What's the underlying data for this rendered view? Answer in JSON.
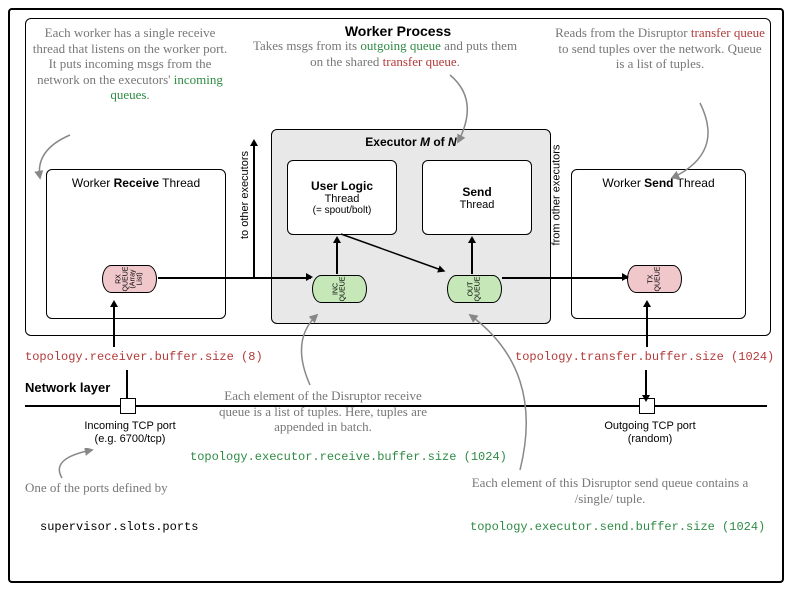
{
  "worker_process_title": "Worker Process",
  "annotations": {
    "recv_thread": "Each worker has a single receive thread that listens on the worker port. It puts incoming msgs from the network on the executors'",
    "recv_thread_green": "incoming queues",
    "send_logic": "Takes msgs from its",
    "send_logic_green": "outgoing queue",
    "send_logic_mid": "and puts them on the shared",
    "send_logic_red": "transfer queue",
    "worker_send": "Reads from the Disruptor",
    "worker_send_red": "transfer queue",
    "worker_send_tail": "to send tuples over the network.  Queue is a list of tuples.",
    "disruptor_recv": "Each element of the Disruptor receive queue is a list of tuples. Here, tuples are appended in batch.",
    "disruptor_send": "Each element of this Disruptor send queue contains a /single/ tuple.",
    "ports_defined": "One of the ports defined by"
  },
  "threads": {
    "worker_receive": "Worker Receive Thread",
    "worker_send": "Worker Send Thread",
    "user_logic_main": "User Logic",
    "user_logic_sub1": "Thread",
    "user_logic_sub2": "(= spout/bolt)",
    "send_main": "Send",
    "send_sub": "Thread"
  },
  "executor_title_prefix": "Executor",
  "executor_title_m": "M",
  "executor_title_of": "of",
  "executor_title_n": "N",
  "queues": {
    "rx": "RX\nQUEUE\n(Array\nList)",
    "inc": "INC\nQUEUE",
    "out": "OUT\nQUEUE",
    "tx": "TX\nQUEUE"
  },
  "vlabels": {
    "to_other": "to other executors",
    "from_other": "from other executors"
  },
  "config": {
    "receiver_buffer": "topology.receiver.buffer.size (8)",
    "transfer_buffer": "topology.transfer.buffer.size (1024)",
    "exec_recv_buffer": "topology.executor.receive.buffer.size (1024)",
    "exec_send_buffer": "topology.executor.send.buffer.size (1024)",
    "supervisor_ports": "supervisor.slots.ports"
  },
  "network": {
    "layer_label": "Network layer",
    "incoming_port": "Incoming TCP port\n(e.g. 6700/tcp)",
    "outgoing_port": "Outgoing TCP port\n(random)"
  }
}
